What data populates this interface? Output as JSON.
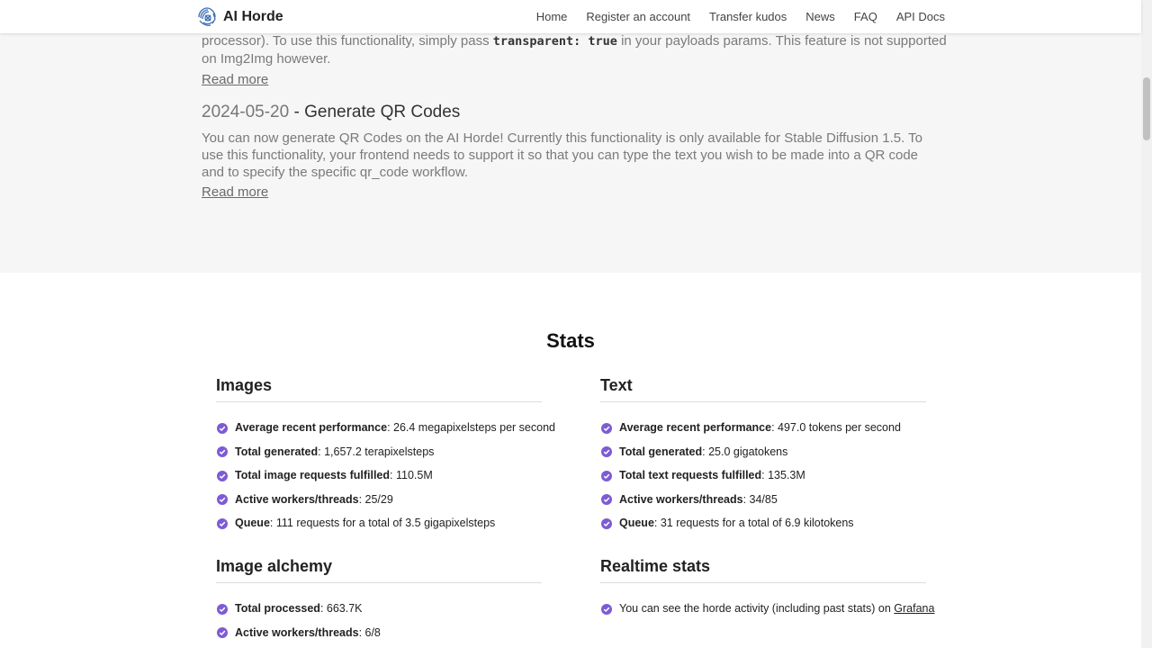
{
  "nav": {
    "brand": "AI Horde",
    "links": [
      "Home",
      "Register an account",
      "Transfer kudos",
      "News",
      "FAQ",
      "API Docs"
    ]
  },
  "news": {
    "item1": {
      "text_start": "processor). To use this functionality, simply pass",
      "code": "transparent: true",
      "text_end": "in your payloads params. This feature is not supported on Img2Img however.",
      "read_more": "Read more"
    },
    "item2": {
      "date": "2024-05-20",
      "separator": " - ",
      "title": "Generate QR Codes",
      "text": "You can now generate QR Codes on the AI Horde! Currently this functionality is only available for Stable Diffusion 1.5. To use this functionality, your frontend needs to support it so that you can type the text you wish to be made into a QR code and to specify the specific qr_code workflow.",
      "read_more": "Read more"
    }
  },
  "stats": {
    "title": "Stats",
    "images": {
      "heading": "Images",
      "items": [
        {
          "label": "Average recent performance",
          "value": ": 26.4 megapixelsteps per second"
        },
        {
          "label": "Total generated",
          "value": ": 1,657.2 terapixelsteps"
        },
        {
          "label": "Total image requests fulfilled",
          "value": ": 110.5M"
        },
        {
          "label": "Active workers/threads",
          "value": ": 25/29"
        },
        {
          "label": "Queue",
          "value": ": 111 requests for a total of 3.5 gigapixelsteps"
        }
      ]
    },
    "text": {
      "heading": "Text",
      "items": [
        {
          "label": "Average recent performance",
          "value": ": 497.0 tokens per second"
        },
        {
          "label": "Total generated",
          "value": ": 25.0 gigatokens"
        },
        {
          "label": "Total text requests fulfilled",
          "value": ": 135.3M"
        },
        {
          "label": "Active workers/threads",
          "value": ": 34/85"
        },
        {
          "label": "Queue",
          "value": ": 31 requests for a total of 6.9 kilotokens"
        }
      ]
    },
    "alchemy": {
      "heading": "Image alchemy",
      "items": [
        {
          "label": "Total processed",
          "value": ": 663.7K"
        },
        {
          "label": "Active workers/threads",
          "value": ": 6/8"
        }
      ]
    },
    "realtime": {
      "heading": "Realtime stats",
      "text": "You can see the horde activity (including past stats) on",
      "link": "Grafana"
    }
  },
  "colors": {
    "accent": "#7d5bd4",
    "news_bg": "#f6f6f6"
  }
}
